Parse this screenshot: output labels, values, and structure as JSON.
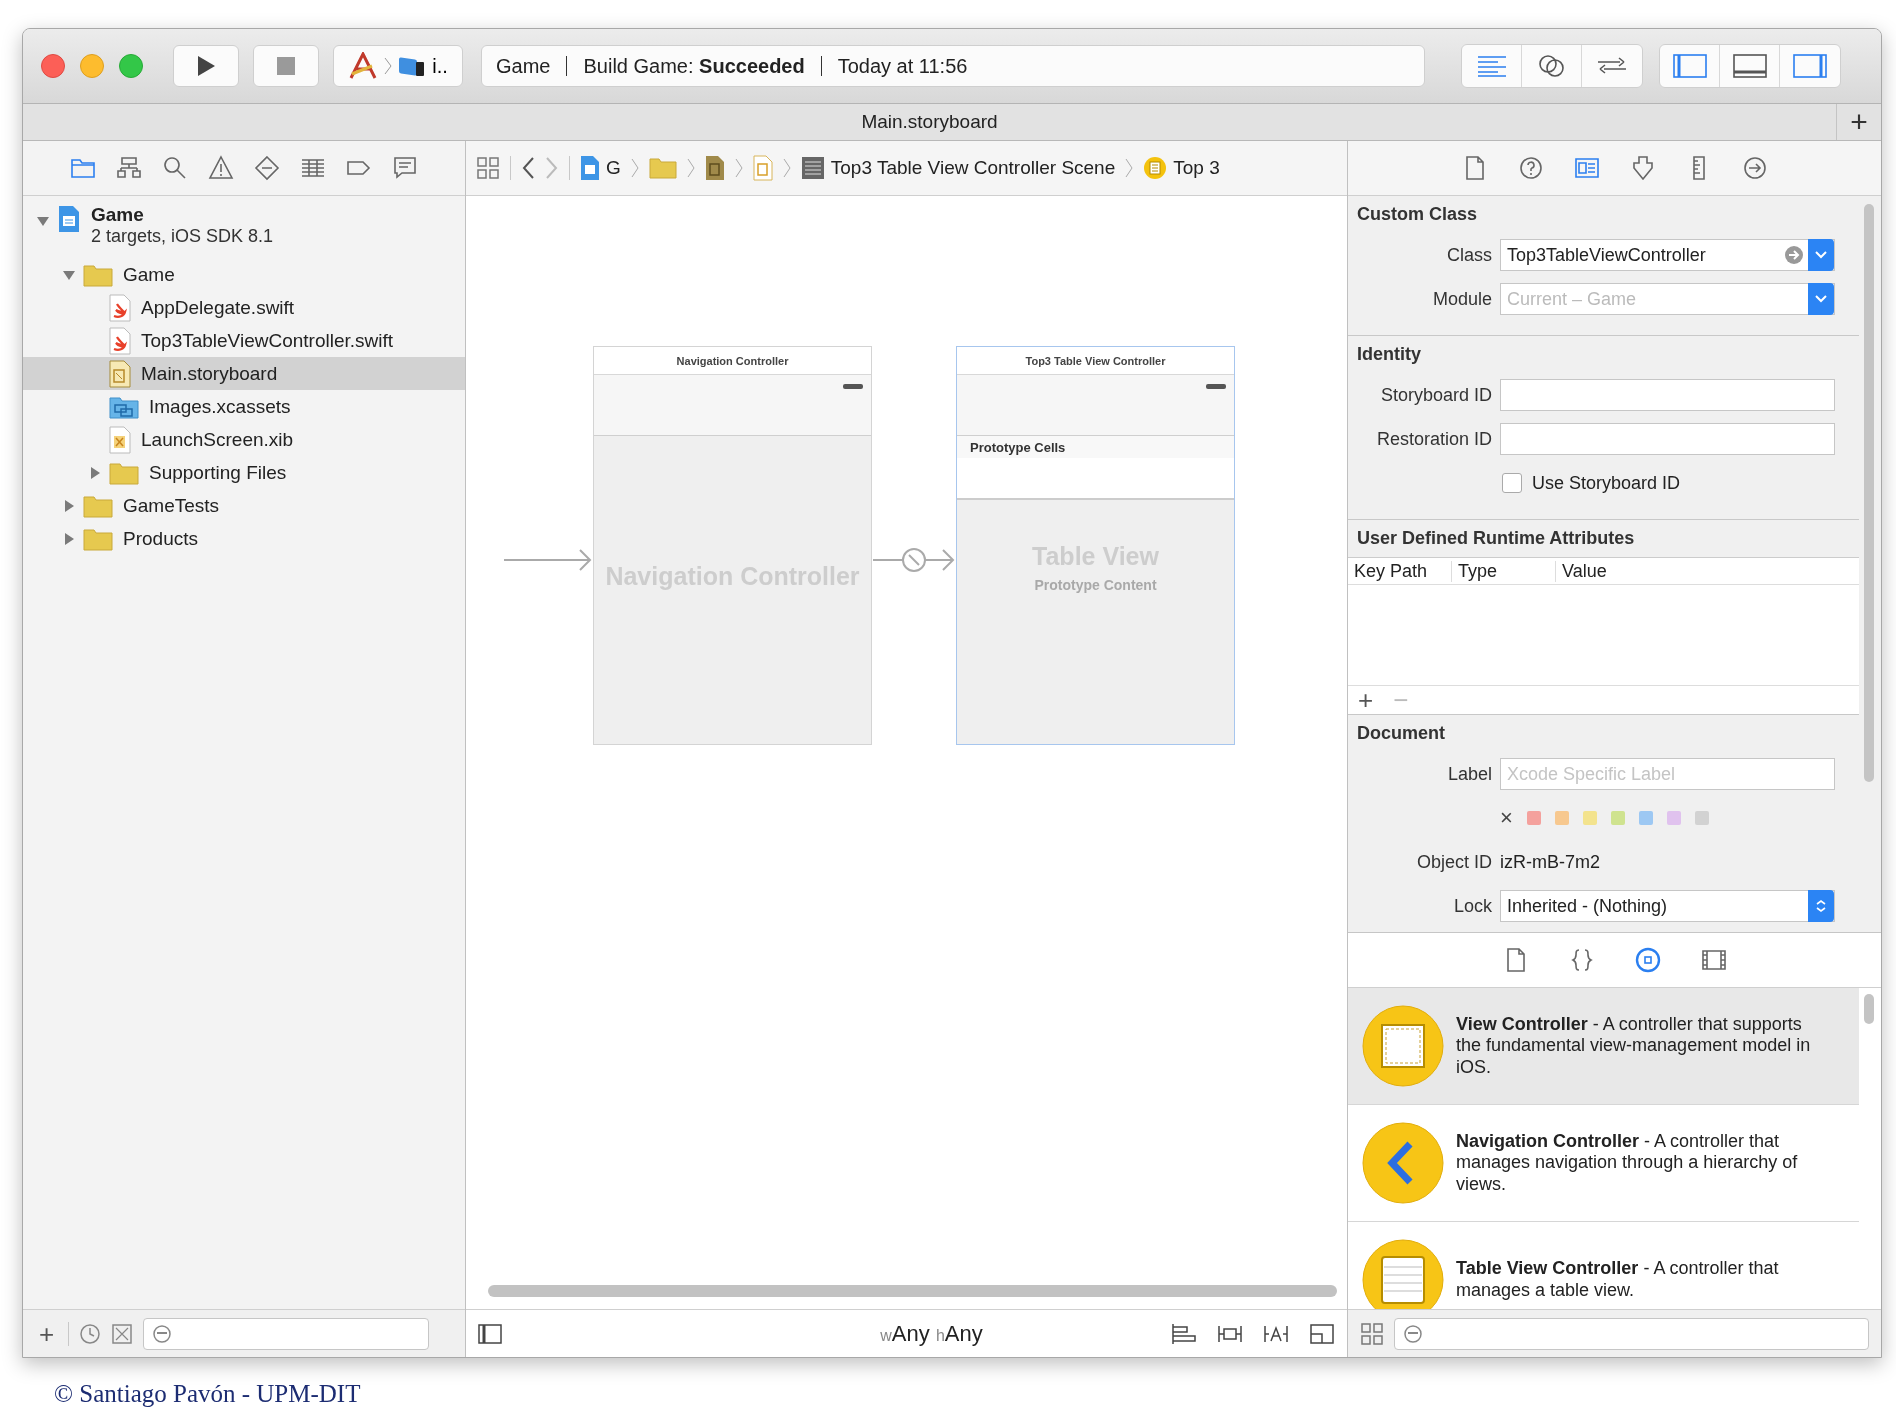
{
  "toolbar": {
    "scheme": {
      "label": "i.."
    },
    "activity": {
      "project": "Game",
      "task": "Build Game: **Succeeded**",
      "time": "Today at 11:56"
    },
    "editor_modes": [
      {
        "kind": "standard",
        "selected": true
      },
      {
        "kind": "assistant",
        "selected": false
      },
      {
        "kind": "version",
        "selected": false
      }
    ],
    "panels": [
      {
        "kind": "navigator",
        "on": true
      },
      {
        "kind": "debug",
        "on": false
      },
      {
        "kind": "utilities",
        "on": true
      }
    ]
  },
  "tab_bar": {
    "title": "Main.storyboard",
    "add": "+"
  },
  "navigator": {
    "tabs": [
      {
        "kind": "project",
        "selected": true
      },
      {
        "kind": "symbol",
        "selected": false
      },
      {
        "kind": "find",
        "selected": false
      },
      {
        "kind": "issue",
        "selected": false
      },
      {
        "kind": "test",
        "selected": false
      },
      {
        "kind": "debug",
        "selected": false
      },
      {
        "kind": "breakpoint",
        "selected": false
      },
      {
        "kind": "log",
        "selected": false
      }
    ],
    "tree": [
      {
        "kind": "project",
        "name": "Game",
        "subtitle": "2 targets, iOS SDK 8.1",
        "expanded": true,
        "selected": false,
        "children": [
          {
            "kind": "folder",
            "name": "Game",
            "expanded": true,
            "selected": false,
            "children": [
              {
                "kind": "swift",
                "name": "AppDelegate.swift",
                "selected": false
              },
              {
                "kind": "swift",
                "name": "Top3TableViewController.swift",
                "selected": false
              },
              {
                "kind": "storyboard",
                "name": "Main.storyboard",
                "selected": true
              },
              {
                "kind": "assets",
                "name": "Images.xcassets",
                "selected": false
              },
              {
                "kind": "xib",
                "name": "LaunchScreen.xib",
                "selected": false
              },
              {
                "kind": "folder",
                "name": "Supporting Files",
                "expanded": false,
                "selected": false
              }
            ]
          },
          {
            "kind": "folder",
            "name": "GameTests",
            "expanded": false,
            "selected": false
          },
          {
            "kind": "folder",
            "name": "Products",
            "expanded": false,
            "selected": false
          }
        ]
      }
    ],
    "add": "+"
  },
  "jump_bar": {
    "items": [
      {
        "kind": "project",
        "label": "G"
      },
      {
        "kind": "folder"
      },
      {
        "kind": "storyboard-base"
      },
      {
        "kind": "storyboard"
      },
      {
        "kind": "scene",
        "label": "Top3 Table View Controller Scene"
      },
      {
        "kind": "controller",
        "label": "Top 3"
      }
    ]
  },
  "canvas": {
    "scenes": [
      {
        "kind": "navigation",
        "title": "Navigation Controller",
        "placeholder": "Navigation Controller",
        "selected": false
      },
      {
        "kind": "table",
        "title": "Top3 Table View Controller",
        "section": "Prototype Cells",
        "placeholder": "Table View",
        "placeholder_sub": "Prototype Content",
        "selected": true
      }
    ],
    "size_class": {
      "width_prefix": "w",
      "width": "Any",
      "height_prefix": "h",
      "height": "Any"
    }
  },
  "inspector": {
    "tabs": [
      {
        "kind": "file",
        "selected": false
      },
      {
        "kind": "help",
        "selected": false
      },
      {
        "kind": "identity",
        "selected": true
      },
      {
        "kind": "attributes",
        "selected": false
      },
      {
        "kind": "size",
        "selected": false
      },
      {
        "kind": "connections",
        "selected": false
      }
    ],
    "custom_class": {
      "title": "Custom Class",
      "class_label": "Class",
      "class_value": "Top3TableViewController",
      "module_label": "Module",
      "module_placeholder": "Current – Game"
    },
    "identity": {
      "title": "Identity",
      "storyboard_id_label": "Storyboard ID",
      "restoration_id_label": "Restoration ID",
      "use_storyboard_id": {
        "label": "Use Storyboard ID",
        "checked": false
      }
    },
    "runtime_attributes": {
      "title": "User Defined Runtime Attributes",
      "columns": [
        "Key Path",
        "Type",
        "Value"
      ],
      "add": "+",
      "remove": "−"
    },
    "document": {
      "title": "Document",
      "label_label": "Label",
      "label_placeholder": "Xcode Specific Label",
      "clear": "×",
      "label_colors": [
        {
          "color": "#f4a19d"
        },
        {
          "color": "#f7c88f"
        },
        {
          "color": "#f3e38e"
        },
        {
          "color": "#cfe38f"
        },
        {
          "color": "#9dc8f3"
        },
        {
          "color": "#e0c2ee"
        },
        {
          "color": "#d2d2d2"
        }
      ],
      "object_id_label": "Object ID",
      "object_id": "izR-mB-7m2",
      "lock_label": "Lock",
      "lock_value": "Inherited - (Nothing)"
    }
  },
  "library": {
    "tabs": [
      {
        "kind": "file",
        "selected": false
      },
      {
        "kind": "code",
        "selected": false
      },
      {
        "kind": "object",
        "selected": true
      },
      {
        "kind": "media",
        "selected": false
      }
    ],
    "items": [
      {
        "kind": "view",
        "text": "**View Controller** - A controller that supports the fundamental view-management model in iOS.",
        "selected": true
      },
      {
        "kind": "navigation",
        "text": "**Navigation Controller** - A controller that manages navigation through a hierarchy of views.",
        "selected": false
      },
      {
        "kind": "table",
        "text": "**Table View Controller** - A controller that manages a table view.",
        "selected": false
      }
    ]
  },
  "footer": "© Santiago Pavón - UPM-DIT"
}
